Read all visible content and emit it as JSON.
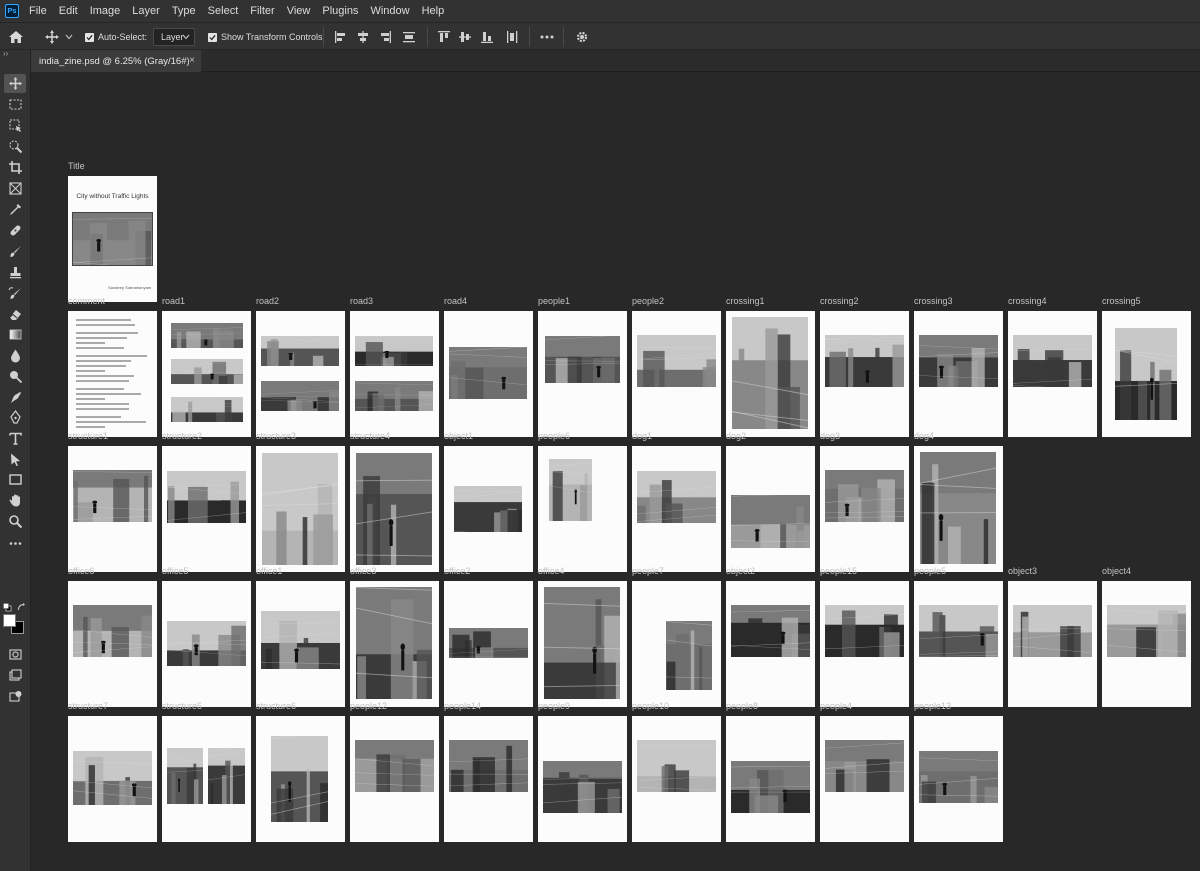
{
  "app": {
    "logo": "Ps"
  },
  "menu": [
    "File",
    "Edit",
    "Image",
    "Layer",
    "Type",
    "Select",
    "Filter",
    "View",
    "Plugins",
    "Window",
    "Help"
  ],
  "options": {
    "auto_select_label": "Auto-Select:",
    "auto_select_checked": true,
    "layer_select_value": "Layer",
    "show_transform_label": "Show Transform Controls",
    "show_transform_checked": true
  },
  "document_tab": {
    "title": "india_zine.psd @ 6.25% (Gray/16#)",
    "close": "×"
  },
  "tools": [
    "move-tool-icon",
    "marquee-tool-icon",
    "object-select-tool-icon",
    "quick-select-tool-icon",
    "crop-tool-icon",
    "frame-tool-icon",
    "eyedropper-tool-icon",
    "healing-brush-tool-icon",
    "brush-tool-icon",
    "clone-stamp-tool-icon",
    "history-brush-tool-icon",
    "eraser-tool-icon",
    "gradient-tool-icon",
    "blur-tool-icon",
    "dodge-tool-icon",
    "smudge-tool-icon",
    "pen-tool-icon",
    "type-tool-icon",
    "path-select-tool-icon",
    "rectangle-tool-icon",
    "hand-tool-icon",
    "zoom-tool-icon",
    "more-tools-icon"
  ],
  "colors": {
    "foreground": "#ffffff",
    "background": "#000000"
  },
  "artboards": [
    [
      "Title"
    ],
    [
      "comment",
      "road1",
      "road2",
      "road3",
      "road4",
      "people1",
      "people2",
      "crossing1",
      "crossing2",
      "crossing3",
      "crossing4",
      "crossing5"
    ],
    [
      "structure1",
      "structure2",
      "structure3",
      "structure4",
      "object1",
      "people6",
      "dog1",
      "dog2",
      "dog3",
      "dog4"
    ],
    [
      "office6",
      "office5",
      "office1",
      "office3",
      "office2",
      "office4",
      "people7",
      "object2",
      "people15",
      "people5",
      "object3",
      "object4"
    ],
    [
      "structure7",
      "structure5",
      "structure6",
      "people12",
      "people14",
      "people9",
      "people10",
      "people8",
      "people4",
      "people13"
    ]
  ],
  "title_page": {
    "top_text": "City without Traffic Lights",
    "bottom_text": "Sandeep Subramanyam"
  }
}
